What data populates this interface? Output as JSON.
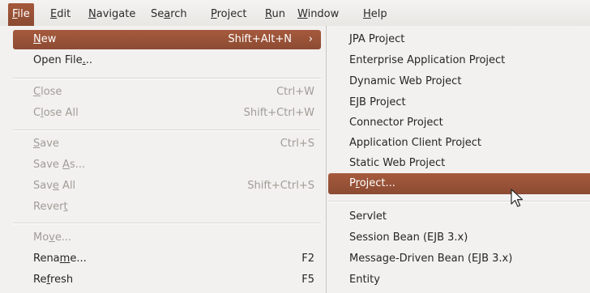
{
  "menubar": {
    "items": [
      {
        "pre": "",
        "mn": "F",
        "post": "ile"
      },
      {
        "pre": "",
        "mn": "E",
        "post": "dit"
      },
      {
        "pre": "",
        "mn": "N",
        "post": "avigate"
      },
      {
        "pre": "Se",
        "mn": "a",
        "post": "rch"
      },
      {
        "pre": "",
        "mn": "P",
        "post": "roject"
      },
      {
        "pre": "",
        "mn": "R",
        "post": "un"
      },
      {
        "pre": "",
        "mn": "W",
        "post": "indow"
      },
      {
        "pre": "",
        "mn": "H",
        "post": "elp"
      }
    ]
  },
  "file_menu": {
    "new": {
      "pre": "",
      "mn": "N",
      "post": "ew",
      "accel": "Shift+Alt+N",
      "arrow": "›"
    },
    "open_file": {
      "pre": "Open File",
      "mn": ".",
      "post": ".."
    },
    "close": {
      "pre": "",
      "mn": "C",
      "post": "lose",
      "accel": "Ctrl+W"
    },
    "close_all": {
      "pre": "C",
      "mn": "l",
      "post": "ose All",
      "accel": "Shift+Ctrl+W"
    },
    "save": {
      "pre": "",
      "mn": "S",
      "post": "ave",
      "accel": "Ctrl+S"
    },
    "save_as": {
      "pre": "Save ",
      "mn": "A",
      "post": "s..."
    },
    "save_all": {
      "pre": "Sav",
      "mn": "e",
      "post": " All",
      "accel": "Shift+Ctrl+S"
    },
    "revert": {
      "pre": "Rever",
      "mn": "t",
      "post": ""
    },
    "move": {
      "pre": "Mo",
      "mn": "v",
      "post": "e..."
    },
    "rename": {
      "pre": "Rena",
      "mn": "m",
      "post": "e...",
      "accel": "F2"
    },
    "refresh": {
      "pre": "Re",
      "mn": "f",
      "post": "resh",
      "accel": "F5"
    }
  },
  "new_submenu": {
    "items": [
      {
        "label": "JPA Project"
      },
      {
        "label": "Enterprise Application Project"
      },
      {
        "label": "Dynamic Web Project"
      },
      {
        "label": "EJB Project"
      },
      {
        "label": "Connector Project"
      },
      {
        "label": "Application Client Project"
      },
      {
        "label": "Static Web Project"
      },
      {
        "pre": "P",
        "mn": "r",
        "post": "oject..."
      },
      {
        "label": "Servlet"
      },
      {
        "label": "Session Bean (EJB 3.x)"
      },
      {
        "label": "Message-Driven Bean (EJB 3.x)"
      },
      {
        "label": "Entity"
      }
    ]
  },
  "colors": {
    "accent": "#9b5236",
    "menu_bg": "#f2f1ef",
    "disabled": "#a09c97"
  }
}
